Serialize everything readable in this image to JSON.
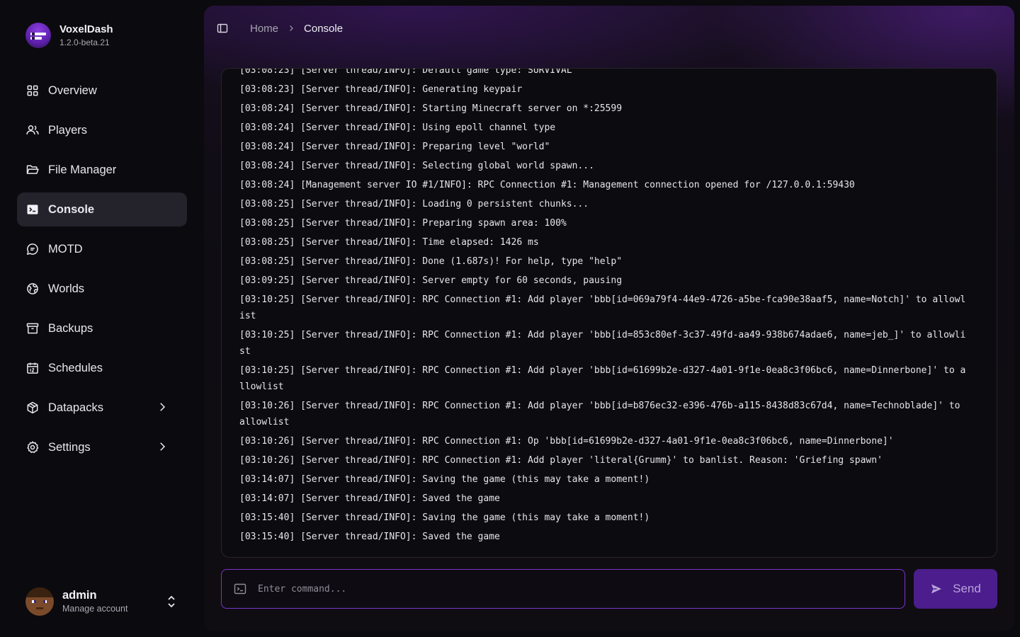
{
  "brand": {
    "name": "VoxelDash",
    "version": "1.2.0-beta.21"
  },
  "nav": [
    {
      "label": "Overview",
      "icon": "grid-icon",
      "active": false
    },
    {
      "label": "Players",
      "icon": "users-icon",
      "active": false
    },
    {
      "label": "File Manager",
      "icon": "folder-open-icon",
      "active": false
    },
    {
      "label": "Console",
      "icon": "terminal-icon",
      "active": true
    },
    {
      "label": "MOTD",
      "icon": "message-icon",
      "active": false
    },
    {
      "label": "Worlds",
      "icon": "globe-icon",
      "active": false
    },
    {
      "label": "Backups",
      "icon": "archive-icon",
      "active": false
    },
    {
      "label": "Schedules",
      "icon": "calendar-icon",
      "active": false
    },
    {
      "label": "Datapacks",
      "icon": "package-icon",
      "active": false,
      "has_submenu": true
    },
    {
      "label": "Settings",
      "icon": "gear-icon",
      "active": false,
      "has_submenu": true
    }
  ],
  "user": {
    "name": "admin",
    "subtitle": "Manage account"
  },
  "breadcrumb": {
    "home": "Home",
    "current": "Console"
  },
  "console": {
    "partial_line": "[03:08:23] [Server thread/INFO]: Default game type: SURVIVAL",
    "lines": [
      "[03:08:23] [Server thread/INFO]: Generating keypair",
      "[03:08:24] [Server thread/INFO]: Starting Minecraft server on *:25599",
      "[03:08:24] [Server thread/INFO]: Using epoll channel type",
      "[03:08:24] [Server thread/INFO]: Preparing level \"world\"",
      "[03:08:24] [Server thread/INFO]: Selecting global world spawn...",
      "[03:08:24] [Management server IO #1/INFO]: RPC Connection #1: Management connection opened for /127.0.0.1:59430",
      "[03:08:25] [Server thread/INFO]: Loading 0 persistent chunks...",
      "[03:08:25] [Server thread/INFO]: Preparing spawn area: 100%",
      "[03:08:25] [Server thread/INFO]: Time elapsed: 1426 ms",
      "[03:08:25] [Server thread/INFO]: Done (1.687s)! For help, type \"help\"",
      "[03:09:25] [Server thread/INFO]: Server empty for 60 seconds, pausing",
      "[03:10:25] [Server thread/INFO]: RPC Connection #1: Add player 'bbb[id=069a79f4-44e9-4726-a5be-fca90e38aaf5, name=Notch]' to allowlist",
      "[03:10:25] [Server thread/INFO]: RPC Connection #1: Add player 'bbb[id=853c80ef-3c37-49fd-aa49-938b674adae6, name=jeb_]' to allowlist",
      "[03:10:25] [Server thread/INFO]: RPC Connection #1: Add player 'bbb[id=61699b2e-d327-4a01-9f1e-0ea8c3f06bc6, name=Dinnerbone]' to allowlist",
      "[03:10:26] [Server thread/INFO]: RPC Connection #1: Add player 'bbb[id=b876ec32-e396-476b-a115-8438d83c67d4, name=Technoblade]' to allowlist",
      "[03:10:26] [Server thread/INFO]: RPC Connection #1: Op 'bbb[id=61699b2e-d327-4a01-9f1e-0ea8c3f06bc6, name=Dinnerbone]'",
      "[03:10:26] [Server thread/INFO]: RPC Connection #1: Add player 'literal{Grumm}' to banlist. Reason: 'Griefing spawn'",
      "[03:14:07] [Server thread/INFO]: Saving the game (this may take a moment!)",
      "[03:14:07] [Server thread/INFO]: Saved the game",
      "[03:15:40] [Server thread/INFO]: Saving the game (this may take a moment!)",
      "[03:15:40] [Server thread/INFO]: Saved the game"
    ]
  },
  "command": {
    "placeholder": "Enter command...",
    "value": "",
    "send_label": "Send"
  },
  "colors": {
    "accent": "#7b34c9",
    "send_bg": "#4c1d8c",
    "active_nav": "#24222b"
  }
}
